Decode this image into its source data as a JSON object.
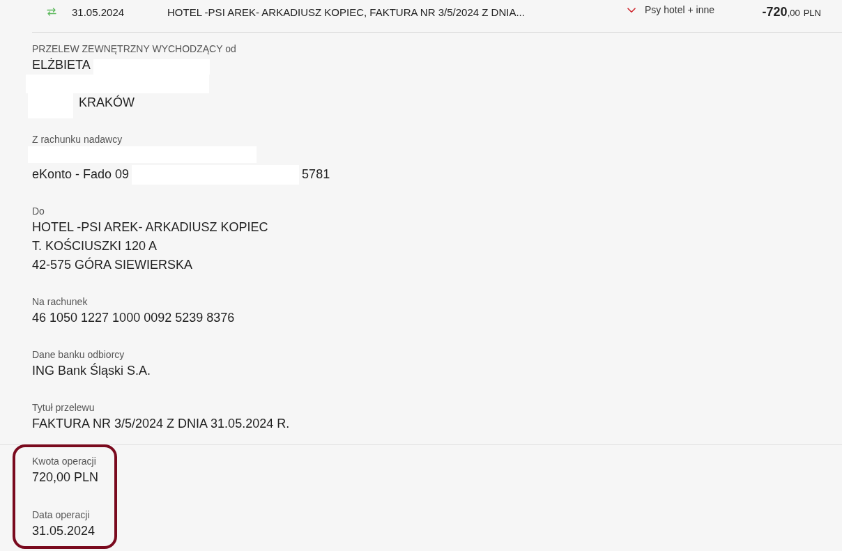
{
  "transaction": {
    "date": "31.05.2024",
    "title": "HOTEL -PSI AREK- ARKADIUSZ KOPIEC, FAKTURA NR 3/5/2024 Z DNIA...",
    "category": "Psy hotel + inne",
    "amount": {
      "whole": "-720",
      "fraction": ",00",
      "currency": "PLN"
    }
  },
  "details": [
    {
      "label": "PRZELEW ZEWNĘTRZNY WYCHODZĄCY od",
      "lines": [
        [
          {
            "kind": "text",
            "text": "ELŻBIETA"
          },
          {
            "kind": "redacted"
          }
        ],
        [
          {
            "kind": "redacted"
          }
        ],
        [
          {
            "kind": "redacted"
          },
          {
            "kind": "text",
            "text": "KRAKÓW"
          }
        ]
      ]
    },
    {
      "label": "Z rachunku nadawcy",
      "lines": [
        [
          {
            "kind": "redacted"
          }
        ],
        [
          {
            "kind": "text",
            "text": "eKonto - Fado 09"
          },
          {
            "kind": "redacted"
          },
          {
            "kind": "text",
            "text": "5781"
          }
        ]
      ]
    },
    {
      "label": "Do",
      "lines": [
        [
          {
            "kind": "text",
            "text": "HOTEL -PSI AREK- ARKADIUSZ KOPIEC"
          }
        ],
        [
          {
            "kind": "text",
            "text": "T. KOŚCIUSZKI 120 A"
          }
        ],
        [
          {
            "kind": "text",
            "text": "42-575 GÓRA SIEWIERSKA"
          }
        ]
      ]
    },
    {
      "label": "Na rachunek",
      "lines": [
        [
          {
            "kind": "text",
            "text": "46 1050 1227 1000 0092 5239 8376"
          }
        ]
      ]
    },
    {
      "label": "Dane banku odbiorcy",
      "lines": [
        [
          {
            "kind": "text",
            "text": "ING Bank Śląski S.A."
          }
        ]
      ]
    },
    {
      "label": "Tytuł przelewu",
      "lines": [
        [
          {
            "kind": "text",
            "text": "FAKTURA NR 3/5/2024 Z DNIA 31.05.2024 R."
          }
        ]
      ]
    }
  ],
  "summary": {
    "highlighted": true,
    "fields": [
      {
        "label": "Kwota operacji",
        "lines": [
          [
            {
              "kind": "text",
              "text": "720,00 PLN"
            }
          ]
        ]
      },
      {
        "label": "Data operacji",
        "lines": [
          [
            {
              "kind": "text",
              "text": "31.05.2024"
            }
          ]
        ]
      }
    ]
  }
}
